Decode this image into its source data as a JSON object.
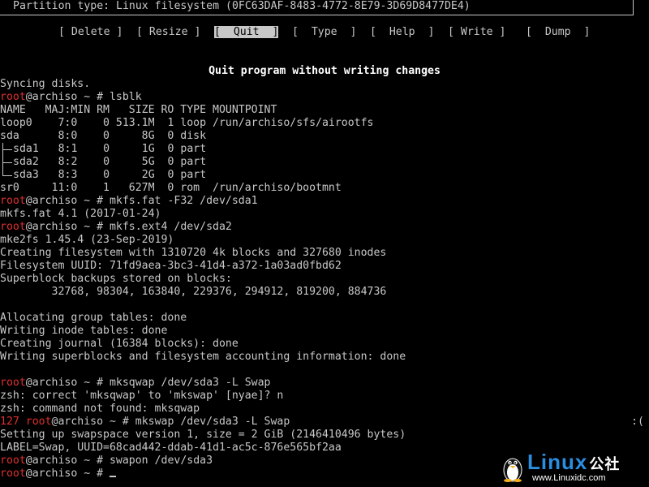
{
  "header": {
    "partition_type": "Partition type: Linux filesystem (0FC63DAF-8483-4772-8E79-3D69D8477DE4)"
  },
  "menu": {
    "delete": "Delete",
    "resize": "Resize",
    "quit": "Quit",
    "type": "Type",
    "help": "Help",
    "write": "Write",
    "dump": "Dump"
  },
  "hint": "Quit program without writing changes",
  "prompt": {
    "user": "root",
    "host_path": "@archiso ~ # ",
    "error_code": "127 "
  },
  "terminal": {
    "syncing": "Syncing disks.",
    "cmd_lsblk": "lsblk",
    "lsblk_header": "NAME   MAJ:MIN RM   SIZE RO TYPE MOUNTPOINT",
    "row_loop0": "loop0    7:0    0 513.1M  1 loop /run/archiso/sfs/airootfs",
    "row_sda": "sda      8:0    0     8G  0 disk",
    "row_sda1": "sda1   8:1    0     1G  0 part",
    "row_sda2": "sda2   8:2    0     5G  0 part",
    "row_sda3": "sda3   8:3    0     2G  0 part",
    "row_sr0": "sr0     11:0    1   627M  0 rom  /run/archiso/bootmnt",
    "cmd_mkfs_fat": "mkfs.fat -F32 /dev/sda1",
    "mkfs_fat_ver": "mkfs.fat 4.1 (2017-01-24)",
    "cmd_mkfs_ext4": "mkfs.ext4 /dev/sda2",
    "mke2fs_ver": "mke2fs 1.45.4 (23-Sep-2019)",
    "creating_fs": "Creating filesystem with 1310720 4k blocks and 327680 inodes",
    "fs_uuid": "Filesystem UUID: 71fd9aea-3bc3-41d4-a372-1a03ad0fbd62",
    "superblock": "Superblock backups stored on blocks:",
    "superblock_list": "        32768, 98304, 163840, 229376, 294912, 819200, 884736",
    "alloc_tables": "Allocating group tables: done",
    "inode_tables": "Writing inode tables: done",
    "journal": "Creating journal (16384 blocks): done",
    "superblocks_written": "Writing superblocks and filesystem accounting information: done",
    "cmd_mksqwap": "mksqwap /dev/sda3 -L Swap",
    "zsh_correct": "zsh: correct 'mksqwap' to 'mkswap' [nyae]? n",
    "zsh_not_found": "zsh: command not found: mksqwap",
    "cmd_mkswap": "mkswap /dev/sda3 -L Swap",
    "frown": ":(",
    "swap_setup": "Setting up swapspace version 1, size = 2 GiB (2146410496 bytes)",
    "swap_label": "LABEL=Swap, UUID=68cad442-ddab-41d1-ac5c-876e565bf2aa",
    "cmd_swapon": "swapon /dev/sda3"
  },
  "watermark": {
    "brand": "Linux",
    "brand_cn": "公社",
    "url": "www.Linuxidc.com"
  },
  "colors": {
    "background": "#000000",
    "text": "#c8c8c8",
    "prompt_user": "#e03030",
    "brand": "#2b8de0"
  },
  "icons": {
    "watermark_logo": "penguin-icon"
  }
}
